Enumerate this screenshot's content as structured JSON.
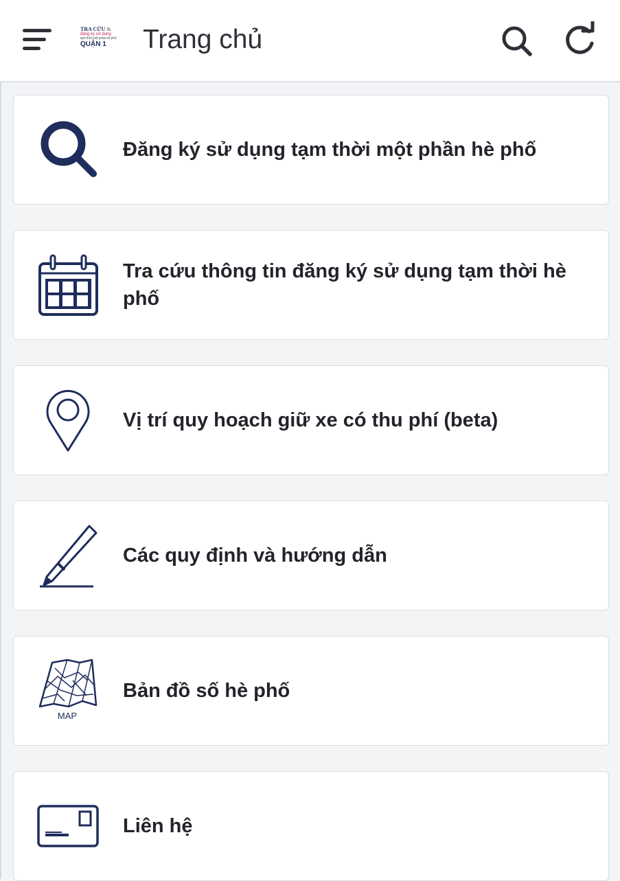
{
  "header": {
    "title": "Trang chủ",
    "logo": {
      "line1": "TRA CỨU",
      "amp": "&",
      "line2": "đăng ký sử dụng",
      "line3": "tạm thời một phần hè phố",
      "line4": "QUẬN 1"
    }
  },
  "menu": {
    "items": [
      {
        "label": "Đăng ký sử dụng tạm thời một phần hè phố",
        "icon": "search-icon"
      },
      {
        "label": "Tra cứu thông tin đăng ký sử dụng tạm thời hè phố",
        "icon": "calendar-icon"
      },
      {
        "label": "Vị trí quy hoạch giữ xe có thu phí (beta)",
        "icon": "map-pin-icon"
      },
      {
        "label": "Các quy định và hướng dẫn",
        "icon": "pen-icon"
      },
      {
        "label": "Bản đồ số hè phố",
        "icon": "map-icon",
        "icon_text": "MAP"
      },
      {
        "label": "Liên hệ",
        "icon": "contact-card-icon"
      }
    ]
  },
  "colors": {
    "icon_navy": "#1f2d5c",
    "text": "#23242b",
    "card_border": "#d9dde2",
    "background": "#f3f4f6"
  }
}
